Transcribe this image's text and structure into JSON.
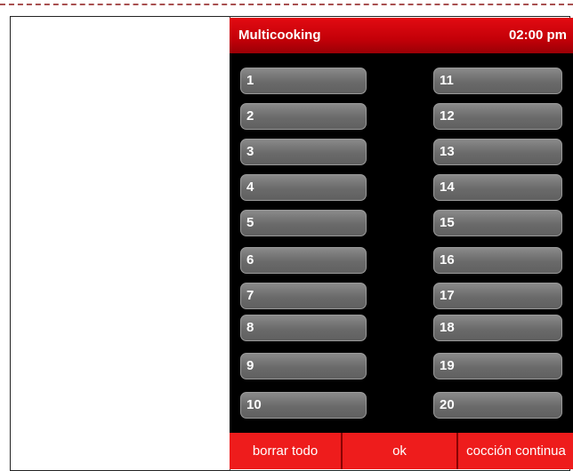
{
  "header": {
    "title": "Multicooking",
    "time": "02:00 pm"
  },
  "slots_left": [
    {
      "label": "1"
    },
    {
      "label": "2"
    },
    {
      "label": "3"
    },
    {
      "label": "4"
    },
    {
      "label": "5"
    },
    {
      "label": "6"
    },
    {
      "label": "7"
    },
    {
      "label": "8"
    },
    {
      "label": "9"
    },
    {
      "label": "10"
    }
  ],
  "slots_right": [
    {
      "label": "11"
    },
    {
      "label": "12"
    },
    {
      "label": "13"
    },
    {
      "label": "14"
    },
    {
      "label": "15"
    },
    {
      "label": "16"
    },
    {
      "label": "17"
    },
    {
      "label": "18"
    },
    {
      "label": "19"
    },
    {
      "label": "20"
    }
  ],
  "footer": {
    "clear_label": "borrar todo",
    "ok_label": "ok",
    "continuous_label": "cocción continua"
  },
  "colors": {
    "header_red": "#c40008",
    "button_red": "#ee1c1c",
    "slot_gray": "#6a6a6a",
    "screen_bg": "#000000"
  }
}
